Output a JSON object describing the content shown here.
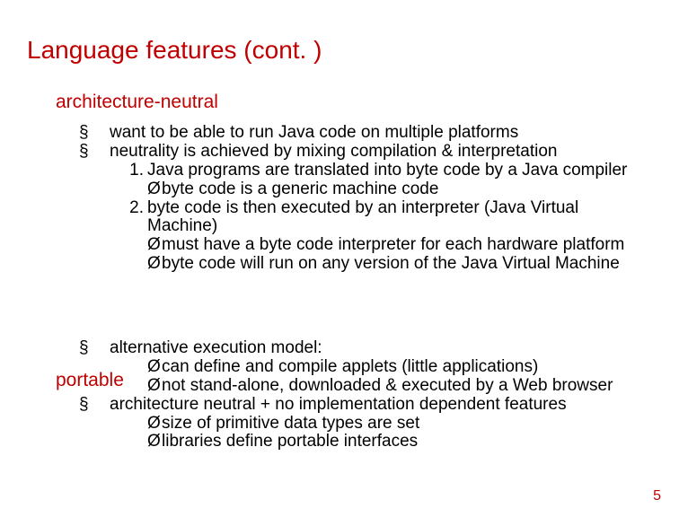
{
  "slide": {
    "title": "Language features (cont. )",
    "section1": {
      "heading": "architecture-neutral",
      "b1": "want to be able to run Java code on multiple platforms",
      "b2": "neutrality is achieved by mixing compilation & interpretation",
      "n1": "Java programs are translated into byte code by a Java compiler",
      "a1": "byte code is a generic machine code",
      "n2": "byte code is then executed by an interpreter (Java Virtual Machine)",
      "a2": "must have a byte code interpreter for each hardware platform",
      "a3": "byte code will run on any version of the Java Virtual Machine"
    },
    "section2": {
      "heading": "portable",
      "b1": "alternative execution model:",
      "a1": "can define and compile applets (little applications)",
      "a2": "not stand-alone, downloaded & executed by a Web browser",
      "b2": "architecture neutral + no implementation dependent features",
      "a3": "size of primitive data types are set",
      "a4": "libraries define portable interfaces"
    },
    "page_number": "5"
  },
  "glyph": {
    "square": "§",
    "arrow": "Ø",
    "num1": "1.",
    "num2": "2."
  }
}
